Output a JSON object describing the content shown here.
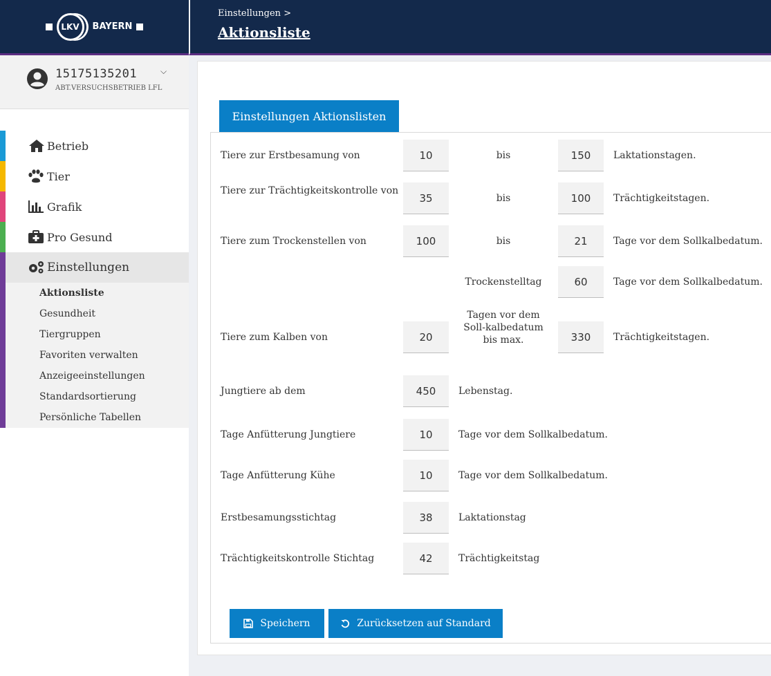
{
  "brand": {
    "logo_text": "LKV",
    "logo_suffix": "BAYERN"
  },
  "user": {
    "id": "15175135201",
    "org": "ABT.VERSUCHSBETRIEB LFL"
  },
  "nav": {
    "items": [
      {
        "label": "Betrieb",
        "color": "#1a9ad6",
        "icon": "home-icon"
      },
      {
        "label": "Tier",
        "color": "#f5b800",
        "icon": "paw-icon"
      },
      {
        "label": "Grafik",
        "color": "#e0457b",
        "icon": "chart-icon"
      },
      {
        "label": "Pro Gesund",
        "color": "#4caf50",
        "icon": "medkit-icon"
      },
      {
        "label": "Einstellungen",
        "color": "#6f3c98",
        "icon": "gears-icon"
      }
    ],
    "sub_items": [
      "Aktionsliste",
      "Gesundheit",
      "Tiergruppen",
      "Favoriten verwalten",
      "Anzeigeeinstellungen",
      "Standardsortierung",
      "Persönliche Tabellen"
    ]
  },
  "header": {
    "breadcrumb": "Einstellungen >",
    "title": "Aktionsliste"
  },
  "form": {
    "title": "Einstellungen Aktionslisten",
    "rows": {
      "erstbesamung": {
        "label": "Tiere zur Erstbesamung von",
        "from": "10",
        "mid": "bis",
        "to": "150",
        "unit": "Laktationstagen."
      },
      "traechtigkeit": {
        "label": "Tiere zur Trächtigkeitskontrolle von",
        "from": "35",
        "mid": "bis",
        "to": "100",
        "unit": "Trächtigkeitstagen."
      },
      "trockenstellen": {
        "label": "Tiere zum Trockenstellen von",
        "from": "100",
        "mid": "bis",
        "to": "21",
        "unit": "Tage vor dem Sollkalbedatum."
      },
      "trockenstelltag": {
        "mid": "Trockenstelltag",
        "value": "60",
        "unit": "Tage vor dem Sollkalbedatum."
      },
      "kalben": {
        "label": "Tiere zum Kalben von",
        "from": "20",
        "mid": "Tagen vor dem Soll-kalbedatum bis max.",
        "to": "330",
        "unit": "Trächtigkeitstagen."
      },
      "jungtiere": {
        "label": "Jungtiere ab dem",
        "value": "450",
        "unit": "Lebenstag."
      },
      "anf_jung": {
        "label": "Tage Anfütterung Jungtiere",
        "value": "10",
        "unit": "Tage vor dem Sollkalbedatum."
      },
      "anf_kuehe": {
        "label": "Tage Anfütterung Kühe",
        "value": "10",
        "unit": "Tage vor dem Sollkalbedatum."
      },
      "eb_stichtag": {
        "label": "Erstbesamungsstichtag",
        "value": "38",
        "unit": "Laktationstag"
      },
      "tk_stichtag": {
        "label": "Trächtigkeitskontrolle Stichtag",
        "value": "42",
        "unit": "Trächtigkeitstag"
      }
    },
    "buttons": {
      "save": "Speichern",
      "reset": "Zurücksetzen auf Standard"
    }
  },
  "colors": {
    "navy": "#13294b",
    "accent_purple": "#5c2e82",
    "primary_blue": "#0a7fc7"
  }
}
